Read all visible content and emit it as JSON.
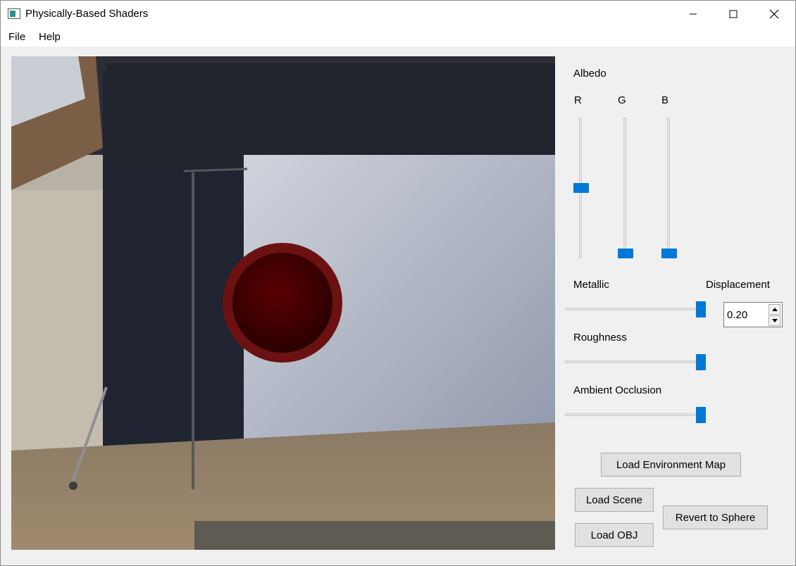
{
  "window": {
    "title": "Physically-Based Shaders"
  },
  "menu": {
    "file": "File",
    "help": "Help"
  },
  "controls": {
    "albedo_label": "Albedo",
    "r_label": "R",
    "g_label": "G",
    "b_label": "B",
    "albedo_r": 0.5,
    "albedo_g": 0.0,
    "albedo_b": 0.0,
    "metallic_label": "Metallic",
    "metallic": 1.0,
    "displacement_label": "Displacement",
    "displacement_value": "0.20",
    "roughness_label": "Roughness",
    "roughness": 1.0,
    "ao_label": "Ambient Occlusion",
    "ao": 1.0
  },
  "buttons": {
    "load_env": "Load Environment Map",
    "load_scene": "Load Scene",
    "load_obj": "Load OBJ",
    "revert": "Revert to Sphere"
  },
  "colors": {
    "accent": "#0078d7",
    "sphere": "#6b0000"
  }
}
